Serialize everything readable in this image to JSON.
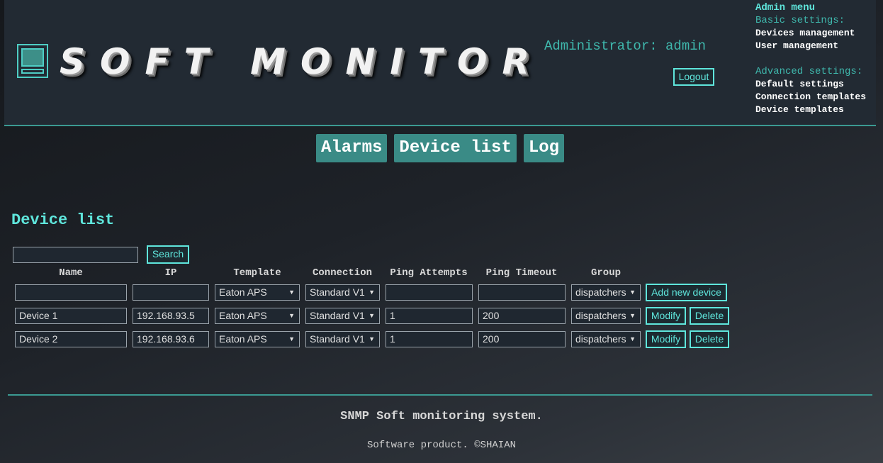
{
  "header": {
    "logo_text": "SOFT MONITOR",
    "admin_label": "Administrator: admin",
    "logout_label": "Logout"
  },
  "admin_menu": {
    "title": "Admin menu",
    "basic_heading": "Basic settings:",
    "basic_items": [
      "Devices management",
      "User management"
    ],
    "advanced_heading": "Advanced settings:",
    "advanced_items": [
      "Default settings",
      "Connection templates",
      "Device templates"
    ]
  },
  "nav": {
    "tabs": [
      {
        "label": "Alarms"
      },
      {
        "label": "Device list"
      },
      {
        "label": "Log"
      }
    ]
  },
  "main": {
    "title": "Device list",
    "search": {
      "value": "",
      "button_label": "Search"
    },
    "columns": [
      "Name",
      "IP",
      "Template",
      "Connection",
      "Ping Attempts",
      "Ping Timeout",
      "Group"
    ],
    "new_row": {
      "name": "",
      "ip": "",
      "template": "Eaton APS",
      "connection": "Standard V1",
      "ping_attempts": "",
      "ping_timeout": "",
      "group": "dispatchers",
      "add_label": "Add new device"
    },
    "rows": [
      {
        "name": "Device 1",
        "ip": "192.168.93.5",
        "template": "Eaton APS",
        "connection": "Standard V1",
        "ping_attempts": "1",
        "ping_timeout": "200",
        "group": "dispatchers",
        "modify_label": "Modify",
        "delete_label": "Delete"
      },
      {
        "name": "Device 2",
        "ip": "192.168.93.6",
        "template": "Eaton APS",
        "connection": "Standard V1",
        "ping_attempts": "1",
        "ping_timeout": "200",
        "group": "dispatchers",
        "modify_label": "Modify",
        "delete_label": "Delete"
      }
    ]
  },
  "footer": {
    "main": "SNMP Soft monitoring system.",
    "sub": "Software product. ©SHAIAN"
  },
  "colors": {
    "accent": "#5fe6dc",
    "header_bg": "#222a33",
    "tab_bg": "#3a8b86"
  },
  "icons": {
    "logo": "monitor-icon",
    "dropdown": "chevron-down-icon"
  }
}
